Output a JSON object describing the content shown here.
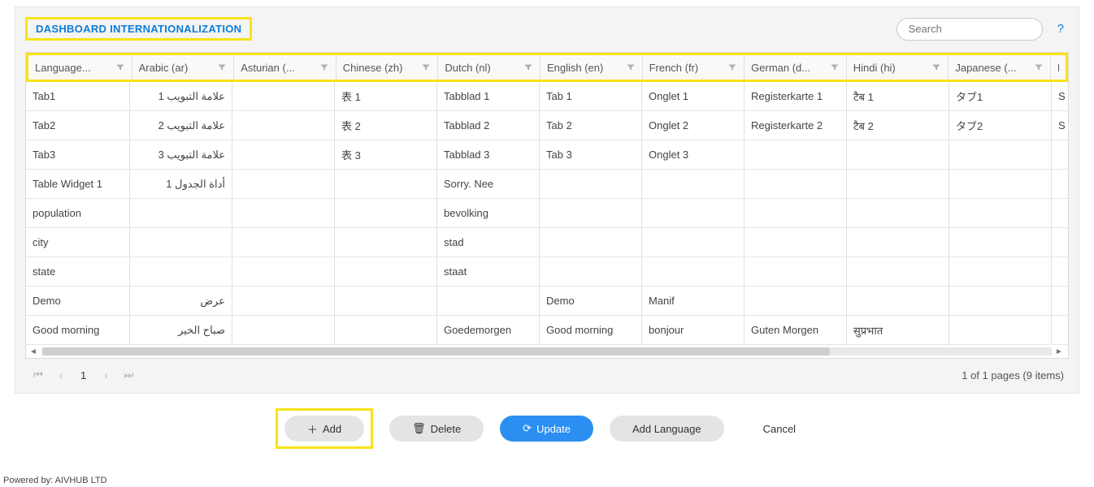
{
  "title": "DASHBOARD INTERNATIONALIZATION",
  "search": {
    "placeholder": "Search"
  },
  "help": "?",
  "columns": [
    "Language...",
    "Arabic (ar)",
    "Asturian (...",
    "Chinese (zh)",
    "Dutch (nl)",
    "English (en)",
    "French (fr)",
    "German (d...",
    "Hindi (hi)",
    "Japanese (...",
    "P"
  ],
  "rows": [
    {
      "language": "Tab1",
      "ar": "علامة التبويب 1",
      "ast": "",
      "zh": "表 1",
      "nl": "Tabblad 1",
      "en": "Tab 1",
      "fr": "Onglet 1",
      "de": "Registerkarte 1",
      "hi": "टैब 1",
      "ja": "タブ1",
      "p": "S"
    },
    {
      "language": "Tab2",
      "ar": "علامة التبويب 2",
      "ast": "",
      "zh": "表 2",
      "nl": "Tabblad 2",
      "en": "Tab 2",
      "fr": "Onglet 2",
      "de": "Registerkarte 2",
      "hi": "टैब 2",
      "ja": "タブ2",
      "p": "S"
    },
    {
      "language": "Tab3",
      "ar": "علامة التبويب 3",
      "ast": "",
      "zh": "表 3",
      "nl": "Tabblad 3",
      "en": "Tab 3",
      "fr": "Onglet 3",
      "de": "",
      "hi": "",
      "ja": "",
      "p": ""
    },
    {
      "language": "Table Widget 1",
      "ar": "أداة الجدول 1",
      "ast": "",
      "zh": "",
      "nl": "Sorry. Nee",
      "en": "",
      "fr": "",
      "de": "",
      "hi": "",
      "ja": "",
      "p": ""
    },
    {
      "language": "population",
      "ar": "",
      "ast": "",
      "zh": "",
      "nl": "bevolking",
      "en": "",
      "fr": "",
      "de": "",
      "hi": "",
      "ja": "",
      "p": ""
    },
    {
      "language": "city",
      "ar": "",
      "ast": "",
      "zh": "",
      "nl": "stad",
      "en": "",
      "fr": "",
      "de": "",
      "hi": "",
      "ja": "",
      "p": ""
    },
    {
      "language": "state",
      "ar": "",
      "ast": "",
      "zh": "",
      "nl": "staat",
      "en": "",
      "fr": "",
      "de": "",
      "hi": "",
      "ja": "",
      "p": ""
    },
    {
      "language": "Demo",
      "ar": "عرض",
      "ast": "",
      "zh": "",
      "nl": "",
      "en": "Demo",
      "fr": "Manif",
      "de": "",
      "hi": "",
      "ja": "",
      "p": ""
    },
    {
      "language": "Good morning",
      "ar": "صباح الخير",
      "ast": "",
      "zh": "",
      "nl": "Goedemorgen",
      "en": "Good morning",
      "fr": "bonjour",
      "de": "Guten Morgen",
      "hi": "सुप्रभात",
      "ja": "",
      "p": ""
    }
  ],
  "pager": {
    "page": "1",
    "summary": "1 of 1 pages (9 items)"
  },
  "buttons": {
    "add": "Add",
    "delete": "Delete",
    "update": "Update",
    "add_language": "Add Language",
    "cancel": "Cancel"
  },
  "footer": "Powered by: AIVHUB LTD"
}
